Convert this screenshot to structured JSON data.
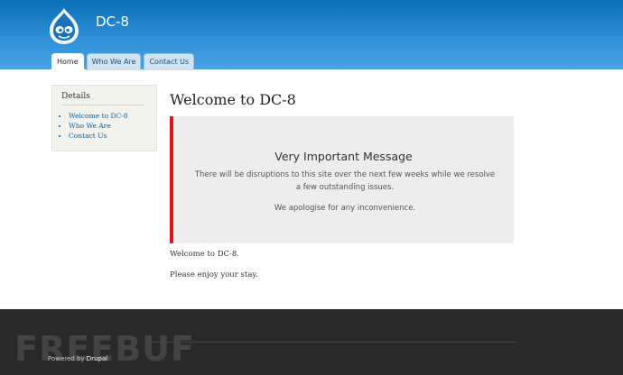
{
  "header": {
    "site_name": "DC-8",
    "tabs": [
      {
        "label": "Home",
        "active": true
      },
      {
        "label": "Who We Are",
        "active": false
      },
      {
        "label": "Contact Us",
        "active": false
      }
    ]
  },
  "sidebar": {
    "title": "Details",
    "links": [
      "Welcome to DC-8",
      "Who We Are",
      "Contact Us"
    ]
  },
  "main": {
    "title": "Welcome to DC-8",
    "message": {
      "title": "Very Important Message",
      "line1": "There will be disruptions to this site over the next few weeks while we resolve a few outstanding issues.",
      "line2": "We apologise for any inconvenience."
    },
    "paragraphs": [
      "Welcome to DC-8.",
      "Please enjoy your stay."
    ]
  },
  "footer": {
    "powered_prefix": "Powered by ",
    "powered_link": "Drupal",
    "watermark": "FREEBUF"
  },
  "colors": {
    "header_blue": "#2f8fd6",
    "message_accent": "#e0121b",
    "footer_bg": "#292929",
    "link": "#0b5c9a"
  }
}
